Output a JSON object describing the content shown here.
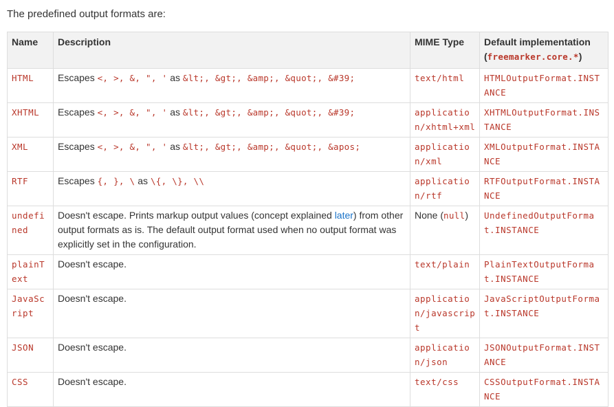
{
  "intro": "The predefined output formats are:",
  "headers": {
    "name": "Name",
    "description": "Description",
    "mime": "MIME Type",
    "impl": "Default implementation",
    "impl_sub_open": "(",
    "impl_sub_code": "freemarker.core.*",
    "impl_sub_close": ")"
  },
  "rows": [
    {
      "name": "HTML",
      "desc": {
        "pre": "Escapes ",
        "chars": "<, >, &, \", '",
        "mid": " as ",
        "escapes": "&lt;, &gt;, &amp;, &quot;, &#39;"
      },
      "mime": "text/html",
      "impl": "HTMLOutputFormat.INSTANCE"
    },
    {
      "name": "XHTML",
      "desc": {
        "pre": "Escapes ",
        "chars": "<, >, &, \", '",
        "mid": " as ",
        "escapes": "&lt;, &gt;, &amp;, &quot;, &#39;"
      },
      "mime": "application/xhtml+xml",
      "impl": "XHTMLOutputFormat.INSTANCE"
    },
    {
      "name": "XML",
      "desc": {
        "pre": "Escapes ",
        "chars": "<, >, &, \", '",
        "mid": " as ",
        "escapes": "&lt;, &gt;, &amp;, &quot;, &apos;"
      },
      "mime": "application/xml",
      "impl": "XMLOutputFormat.INSTANCE"
    },
    {
      "name": "RTF",
      "desc": {
        "pre": "Escapes ",
        "chars": "{, }, \\",
        "mid": " as ",
        "escapes": "\\{, \\}, \\\\"
      },
      "mime": "application/rtf",
      "impl": "RTFOutputFormat.INSTANCE"
    },
    {
      "name": "undefined",
      "desc_undefined": {
        "part1": "Doesn't escape. Prints markup output values (concept explained ",
        "link": "later",
        "part2": ") from other output formats as is. The default output format used when no output format was explicitly set in the configuration."
      },
      "mime_none": {
        "pre": "None (",
        "code": "null",
        "post": ")"
      },
      "impl": "UndefinedOutputFormat.INSTANCE"
    },
    {
      "name": "plainText",
      "desc_plain": "Doesn't escape.",
      "mime": "text/plain",
      "impl": "PlainTextOutputFormat.INSTANCE"
    },
    {
      "name": "JavaScript",
      "desc_plain": "Doesn't escape.",
      "mime": "application/javascript",
      "impl": "JavaScriptOutputFormat.INSTANCE"
    },
    {
      "name": "JSON",
      "desc_plain": "Doesn't escape.",
      "mime": "application/json",
      "impl": "JSONOutputFormat.INSTANCE"
    },
    {
      "name": "CSS",
      "desc_plain": "Doesn't escape.",
      "mime": "text/css",
      "impl": "CSSOutputFormat.INSTANCE"
    }
  ]
}
